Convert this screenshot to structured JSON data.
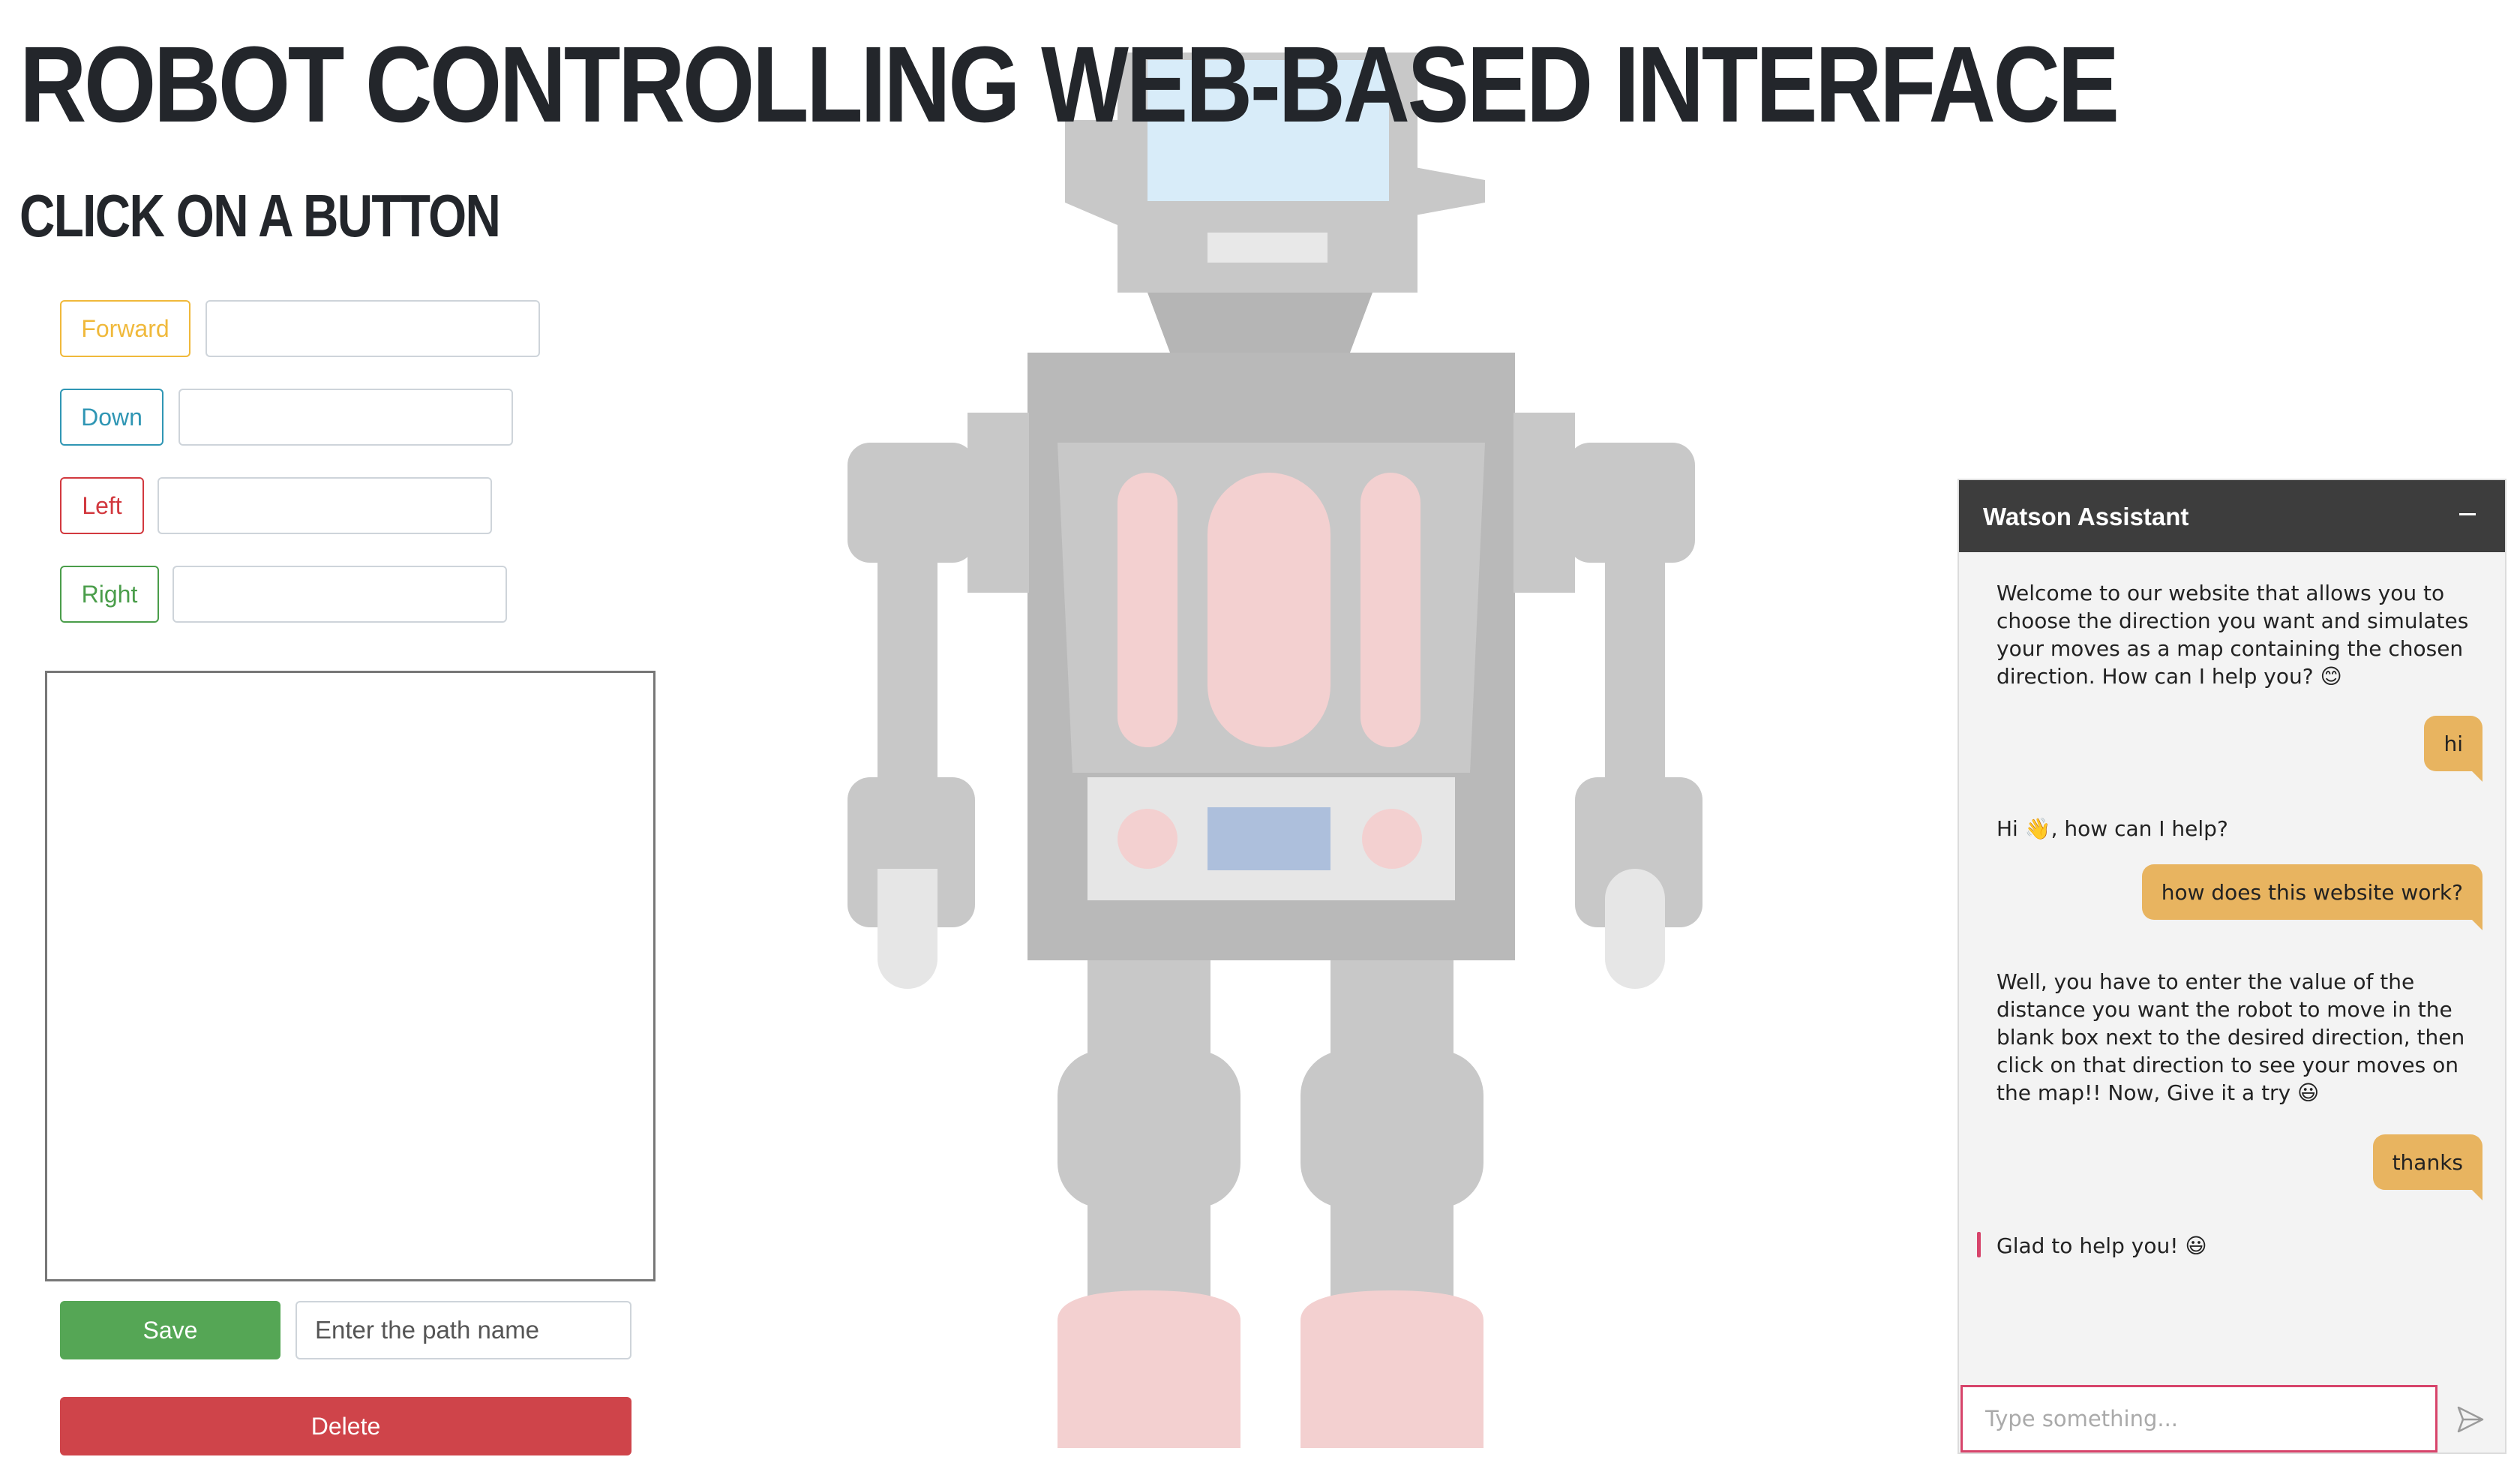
{
  "page": {
    "title": "Robot controlling web-based interface",
    "subtitle": "Click on a button"
  },
  "controls": {
    "forward_label": "Forward",
    "down_label": "Down",
    "left_label": "Left",
    "right_label": "Right",
    "forward_value": "",
    "down_value": "",
    "left_value": "",
    "right_value": "",
    "save_label": "Save",
    "path_placeholder": "Enter the path name",
    "delete_label": "Delete"
  },
  "colors": {
    "forward": "#f0b93b",
    "down": "#2f96b4",
    "left": "#d2393f",
    "right": "#4a9d4a"
  },
  "chat": {
    "title": "Watson Assistant",
    "minimize_icon": "minus-icon",
    "messages": [
      {
        "from": "bot",
        "text": "Welcome to our website that allows you to choose the direction you want and simulates your moves as a map containing the chosen direction. How can I help you? 😊"
      },
      {
        "from": "user",
        "text": "hi"
      },
      {
        "from": "bot",
        "text": "Hi 👋, how can I help?"
      },
      {
        "from": "user",
        "text": "how does this website work?"
      },
      {
        "from": "bot",
        "text": "Well, you have to enter the value of the distance you want the robot to move in the blank box next to the desired direction, then click on that direction to see your moves on the map!! Now, Give it a try 😃"
      },
      {
        "from": "user",
        "text": "thanks"
      },
      {
        "from": "bot",
        "text": "Glad to help you! 😃"
      }
    ],
    "input_placeholder": "Type something...",
    "send_icon": "send-icon"
  }
}
